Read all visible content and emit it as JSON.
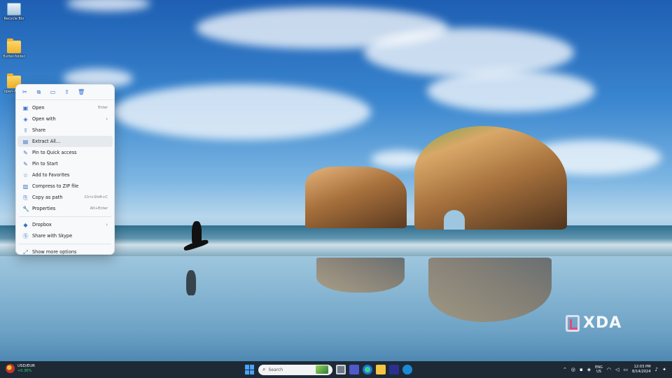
{
  "desktop": {
    "icons": [
      {
        "label": "Recycle Bin"
      },
      {
        "label": "flutter-folder"
      },
      {
        "label": "open-Ai-file"
      }
    ]
  },
  "context_menu": {
    "top_actions": [
      {
        "icon": "cut-icon"
      },
      {
        "icon": "copy-icon"
      },
      {
        "icon": "rename-icon"
      },
      {
        "icon": "share-icon"
      },
      {
        "icon": "delete-icon"
      }
    ],
    "items": [
      {
        "label": "Open",
        "shortcut": "Enter",
        "icon": "open-icon"
      },
      {
        "label": "Open with",
        "submenu": "›",
        "icon": "open-with-icon"
      },
      {
        "label": "Share",
        "icon": "share-icon"
      },
      {
        "label": "Extract All...",
        "icon": "extract-icon",
        "highlighted": true
      },
      {
        "label": "Pin to Quick access",
        "icon": "pin-icon"
      },
      {
        "label": "Pin to Start",
        "icon": "pin-icon"
      },
      {
        "label": "Add to Favorites",
        "icon": "star-icon"
      },
      {
        "label": "Compress to ZIP file",
        "icon": "zip-icon"
      },
      {
        "label": "Copy as path",
        "shortcut": "Ctrl+Shift+C",
        "icon": "path-icon"
      },
      {
        "label": "Properties",
        "shortcut": "Alt+Enter",
        "icon": "wrench-icon"
      }
    ],
    "items2": [
      {
        "label": "Dropbox",
        "submenu": "›",
        "icon": "dropbox-icon"
      },
      {
        "label": "Share with Skype",
        "icon": "skype-icon"
      }
    ],
    "more": {
      "label": "Show more options",
      "icon": "more-options-icon"
    }
  },
  "watermark": {
    "word": "XDA"
  },
  "taskbar": {
    "ticker": {
      "pair": "USD/EUR",
      "change": "+0.36%"
    },
    "search": {
      "placeholder": "Search"
    },
    "tray": {
      "lang_top": "ENG",
      "lang_bottom": "US",
      "time": "12:03 PM",
      "date": "8/14/2024"
    }
  },
  "colors": {
    "taskbar_bg": "#1d2a36",
    "accent": "#4aa3ff",
    "menu_bg": "#f7f9fb",
    "ticker_green": "#3ad06b"
  }
}
